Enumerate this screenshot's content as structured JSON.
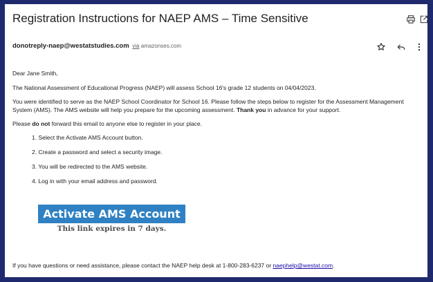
{
  "email": {
    "subject": "Registration Instructions for NAEP AMS – Time Sensitive",
    "sender": {
      "email": "donotreply-naep@westatstudies.com",
      "via_word": "via",
      "via_domain": "amazonses.com"
    },
    "icons": {
      "print": "print-icon",
      "popout": "open-in-new-window-icon",
      "star": "star-icon",
      "reply": "reply-icon",
      "more": "more-vert-icon"
    },
    "body": {
      "greeting": "Dear Jane Smith,",
      "para1": "The National Assessment of Educational Progress (NAEP) will assess School 16's grade 12 students on 04/04/2023.",
      "para2_a": "You were identified to serve as the NAEP School Coordinator for School 16. Please follow the steps below to register for the Assessment Management System (AMS). The AMS website will help you prepare for the upcoming assessment. ",
      "para2_bold": "Thank you",
      "para2_b": " in advance for your support.",
      "para3_a": "Please ",
      "para3_bold": "do not",
      "para3_b": " forward this email to anyone else to register in your place.",
      "steps": [
        "1. Select the Activate AMS Account button.",
        "2. Create a password and select a security image.",
        "3. You will be redirected to the AMS website.",
        "4. Log in with your email address and password."
      ]
    },
    "cta": {
      "label": "Activate AMS Account",
      "note": "This link expires in 7 days."
    },
    "footer": {
      "text": "If you have questions or need assistance, please contact the NAEP help desk at 1-800-283-6237 or ",
      "link": "naephelp@westat.com",
      "end": "."
    }
  }
}
